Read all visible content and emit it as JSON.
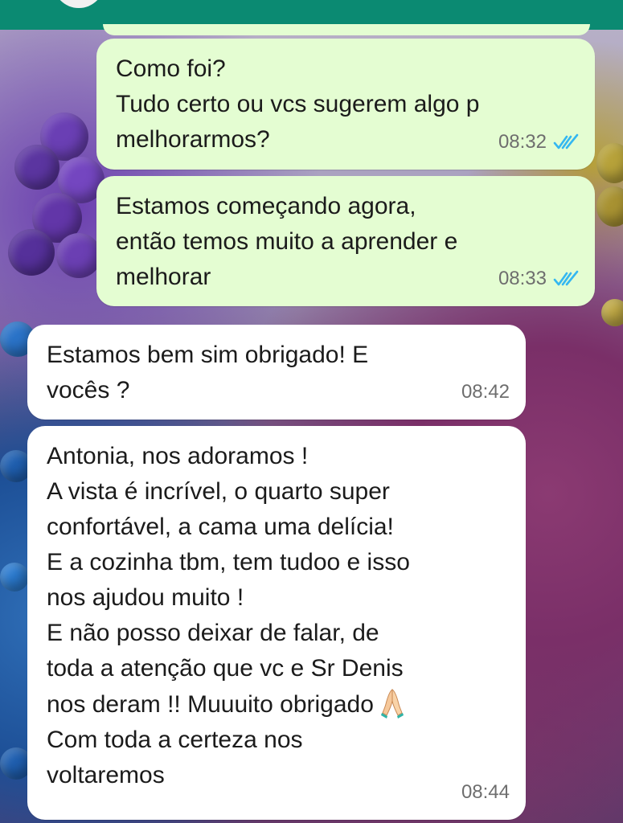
{
  "messages": [
    {
      "direction": "outgoing",
      "text": "Como foi?\nTudo certo ou vcs sugerem algo p\nmelhorarmos?",
      "time": "08:32",
      "status": "read-double-check-icon"
    },
    {
      "direction": "outgoing",
      "text": "Estamos começando agora,\nentão temos muito a aprender e\nmelhorar",
      "time": "08:33",
      "status": "read-double-check-icon"
    },
    {
      "direction": "incoming",
      "text": "Estamos bem sim obrigado! E\nvocês ?",
      "time": "08:42"
    },
    {
      "direction": "incoming",
      "text_before_emoji": "Antonia, nos adoramos !\nA vista é incrível, o quarto super\nconfortável, a cama uma delícia!\nE a cozinha tbm, tem tudoo e isso\nnos ajudou muito !\nE não posso deixar de falar, de\ntoda a atenção que vc e Sr Denis\nnos deram !! Muuuito obrigado",
      "emoji": "folded-hands-icon",
      "text_after_emoji": "Com toda a certeza nos\nvoltaremos",
      "time": "08:44"
    }
  ],
  "colors": {
    "header": "#0b8a72",
    "outgoing_bubble": "#e4fdd2",
    "incoming_bubble": "#ffffff",
    "read_ticks": "#34b7f1",
    "timestamp": "#6e6e6e"
  }
}
